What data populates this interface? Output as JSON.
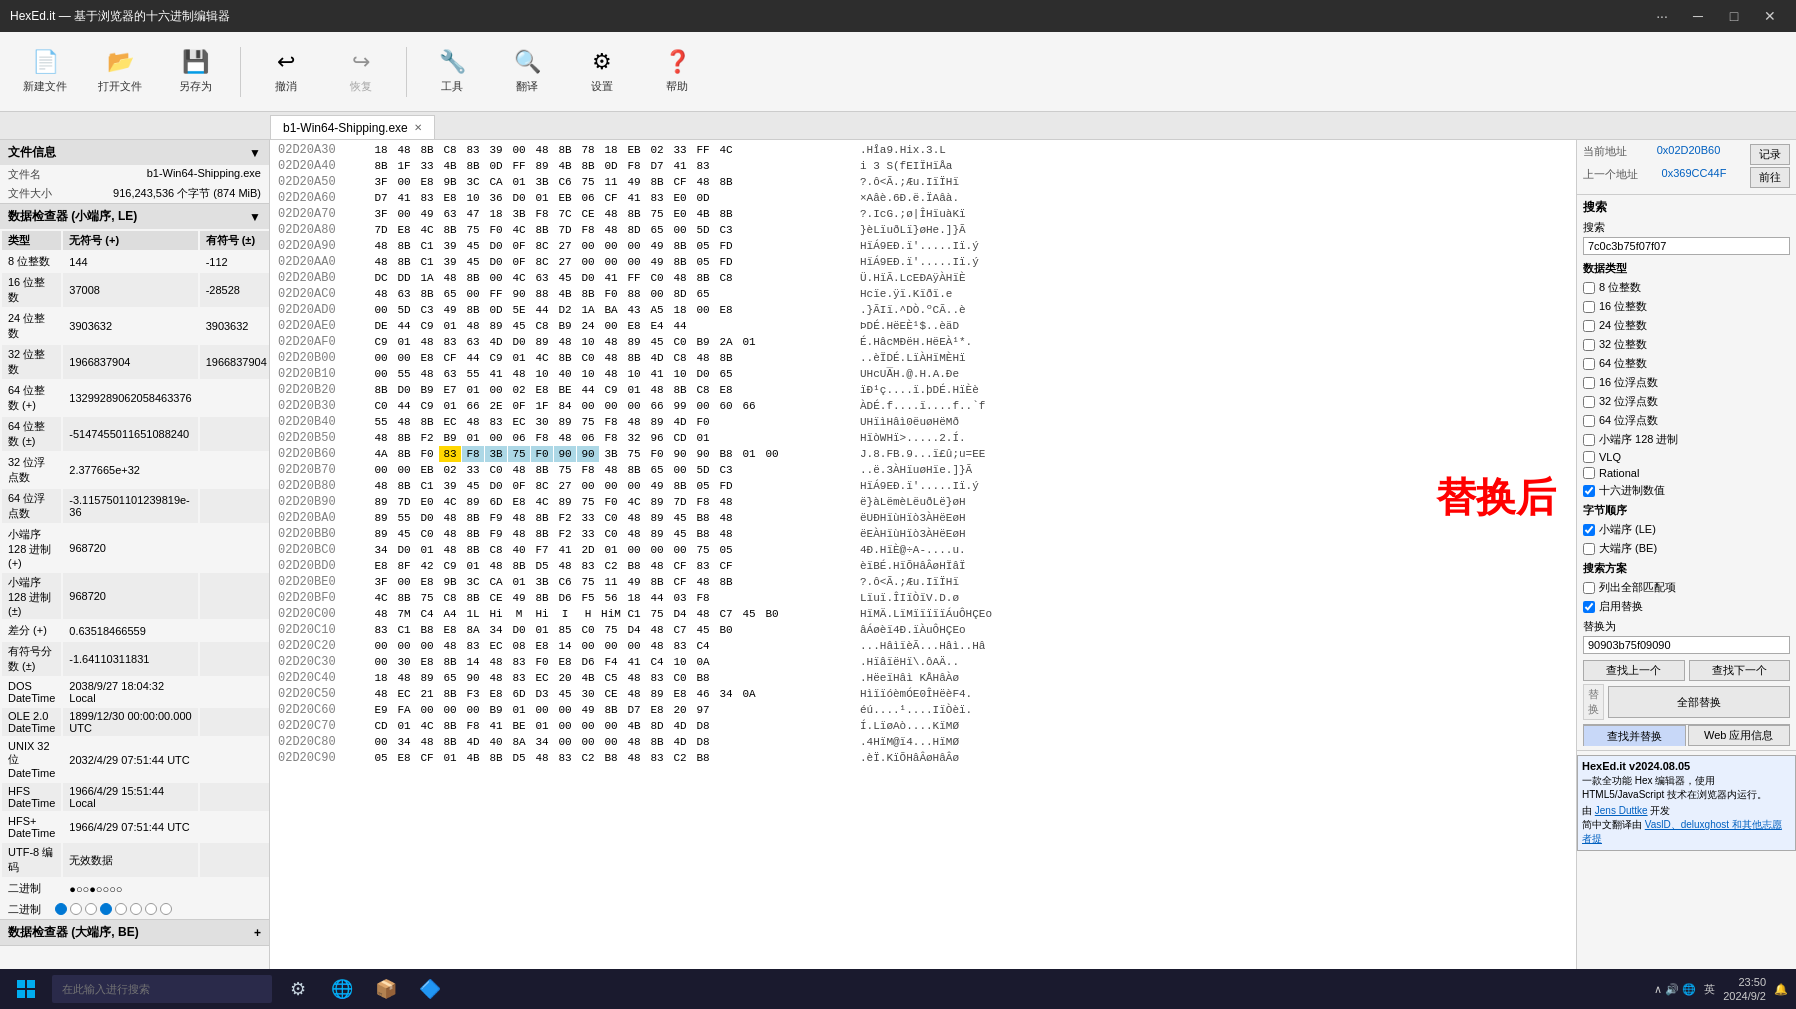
{
  "titlebar": {
    "title": "HexEd.it — 基于浏览器的十六进制编辑器",
    "minimize": "─",
    "restore": "□",
    "close": "✕",
    "more": "···"
  },
  "toolbar": {
    "items": [
      {
        "id": "new",
        "icon": "📄",
        "label": "新建文件"
      },
      {
        "id": "open",
        "icon": "📂",
        "label": "打开文件"
      },
      {
        "id": "saveas",
        "icon": "💾",
        "label": "另存为"
      },
      {
        "id": "undo",
        "icon": "↩",
        "label": "撤消"
      },
      {
        "id": "redo",
        "icon": "↪",
        "label": "恢复"
      },
      {
        "id": "tools",
        "icon": "🔧",
        "label": "工具"
      },
      {
        "id": "translate",
        "icon": "🔍",
        "label": "翻译"
      },
      {
        "id": "settings",
        "icon": "⚙",
        "label": "设置"
      },
      {
        "id": "help",
        "icon": "❓",
        "label": "帮助"
      }
    ]
  },
  "tab": {
    "label": "b1-Win64-Shipping.exe",
    "close": "✕"
  },
  "left_panel": {
    "file_info_title": "文件信息",
    "file_info": {
      "name_label": "文件名",
      "name_val": "b1-Win64-Shipping.exe",
      "size_label": "文件大小",
      "size_val": "916,243,536 个字节 (874 MiB)"
    },
    "checker_title": "数据检查器 (小端序, LE)",
    "type_header": [
      "类型",
      "无符号 (+)",
      "有符号 (±)"
    ],
    "types": [
      [
        "8 位整数",
        "144",
        "-112"
      ],
      [
        "16 位整数",
        "37008",
        "-28528"
      ],
      [
        "24 位整数",
        "3903632",
        "3903632"
      ],
      [
        "32 位整数",
        "1966837904",
        "1966837904"
      ],
      [
        "64 位整数 (+)",
        "13299289062058463376",
        ""
      ],
      [
        "64 位整数 (±)",
        "-5147455011651088240",
        ""
      ],
      [
        "32 位浮点数",
        "2.377665e+32",
        ""
      ],
      [
        "64 位浮点数",
        "-3.1157501101239819e-36",
        ""
      ],
      [
        "小端序 128 进制 (+)",
        "968720",
        ""
      ],
      [
        "小端序 128 进制 (±)",
        "968720",
        ""
      ],
      [
        "差分 (+)",
        "0.63518466559",
        ""
      ],
      [
        "有符号分数 (±)",
        "-1.64110311831",
        ""
      ],
      [
        "DOS DateTime",
        "2038/9/27 18:04:32 Local",
        ""
      ],
      [
        "OLE 2.0 DateTime",
        "1899/12/30 00:00:00.000 UTC",
        ""
      ],
      [
        "UNIX 32 位 DateTime",
        "2032/4/29 07:51:44 UTC",
        ""
      ],
      [
        "HFS DateTime",
        "1966/4/29 15:51:44 Local",
        ""
      ],
      [
        "HFS+ DateTime",
        "1966/4/29 07:51:44 UTC",
        ""
      ],
      [
        "UTF-8 编码",
        "无效数据",
        ""
      ],
      [
        "二进制",
        "●○○●○○○○",
        ""
      ]
    ],
    "checker2_title": "数据检查器 (大端序, BE)"
  },
  "hex_rows": [
    {
      "addr": "02D20A30",
      "bytes": "18 48 8B C8 83 39 00 48 8B 78 18 EB 02 33 FF 4C",
      "ascii": ".Hi̊a9.Hix.3.L"
    },
    {
      "addr": "02D20A40",
      "bytes": "8B 1F 33 4B 8B 0D FF 89 4B 8B 0D F8 D7 41 83",
      "ascii": "i 3 S(fEIΪHïÅa"
    },
    {
      "addr": "02D20A50",
      "bytes": "3F 00 E8 9B 3C CA 01 3B C6 75 11 49 8B CF 48 8B",
      "ascii": "?.ô<Ã.;Æu.IïÏHï"
    },
    {
      "addr": "02D20A60",
      "bytes": "D7 41 83 E8 10 36 D0 01 EB 06 CF 41 83 E0 0D",
      "ascii": "×Aâè.6Ð.ë.ÏAâà."
    },
    {
      "addr": "02D20A70",
      "bytes": "3F 00 49 63 47 18 3B F8 7C CE 48 8B 75 E0 4B 8B",
      "ascii": "?.IcG.;ø|ÎHïuàKï"
    },
    {
      "addr": "02D20A80",
      "bytes": "7D E8 4C 8B 75 F0 4C 8B 7D F8 48 8D 65 00 5D C3",
      "ascii": "}èLïuðLï}øHe.]}Ã"
    },
    {
      "addr": "02D20A90",
      "bytes": "48 8B C1 39 45 D0 0F 8C 27 00 00 00 49 8B 05 FD",
      "ascii": "HïÁ9EÐ.ï'.....Iï.ý"
    },
    {
      "addr": "02D20AA0",
      "bytes": "48 8B C1 39 45 D0 0F 8C 27 00 00 00 49 8B 05 FD",
      "ascii": "HïÁ9EÐ.ï'.....Iï.ý"
    },
    {
      "addr": "02D20AB0",
      "bytes": "DC DD 1A 48 8B 00 4C 63 45 D0 41 FF C0 48 8B C8",
      "ascii": "Ü.HïÃ.LcEÐAÿÀHïÈ"
    },
    {
      "addr": "02D20AC0",
      "bytes": "48 63 8B 65 00 FF 90 88 4B 8B F0 88 00 8D 65",
      "ascii": "Hcïe.ÿï.Kïðï.e"
    },
    {
      "addr": "02D20AD0",
      "bytes": "00 5D C3 49 8B 0D 5E 44 D2 1A BA 43 A5 18 00 E8",
      "ascii": ".}ÃIï.^DÒ.ºCÃ..è"
    },
    {
      "addr": "02D20AE0",
      "bytes": "DE 44 C9 01 48 89 45 C8 B9 24 00 E8 E4 44",
      "ascii": "ÞDÉ.HëEÈ¹$..èäD"
    },
    {
      "addr": "02D20AF0",
      "bytes": "C9 01 48 83 63 4D D0 89 48 10 48 89 45 C0 B9 2A 01",
      "ascii": "É.HâcMÐëH.HëEÀ¹*."
    },
    {
      "addr": "02D20B00",
      "bytes": "00 00 E8 CF 44 C9 01 4C 8B C0 48 8B 4D C8 48 8B",
      "ascii": "..èÏDÉ.LïÀHïMÈHï"
    },
    {
      "addr": "02D20B10",
      "bytes": "00 55 48 63 55 41 48 10 40 10 48 10 41 10 D0 65",
      "ascii": "UHcUA̅H.@.H.A.Ðe"
    },
    {
      "addr": "02D20B20",
      "bytes": "8B D0 B9 E7 01 00 02 E8 BE 44 C9 01 48 8B C8 E8",
      "ascii": "ïÐ¹ç....ï.þDÉ.HïÈè"
    },
    {
      "addr": "02D20B30",
      "bytes": "C0 44 C9 01 66 2E 0F 1F 84 00 00 00 66 99 00 60 66",
      "ascii": "ÀDÉ.f....ï....f..`f"
    },
    {
      "addr": "02D20B40",
      "bytes": "55 48 8B EC 48 83 EC 30 89 75 F8 48 89 4D F0",
      "ascii": "UHïìHâì0ëuøHëMð"
    },
    {
      "addr": "02D20B50",
      "bytes": "48 8B F2 B9 01 00 06 F8 48 06 F8 32 96 CD 01",
      "ascii": "HïòWHï>.....2.Í."
    },
    {
      "addr": "02D20B60",
      "bytes": "4A 8B F0 83 F8 3B 75 F0 90 90 3B 75 F0 90 90 B8 01 00",
      "ascii": "J.8.FB.9...ï£û;u=EE"
    },
    {
      "addr": "02D20B70",
      "bytes": "00 00 EB 02 33 C0 48 8B 75 F8 48 8B 65 00 5D C3",
      "ascii": "..ë.3ÀHïuøHïe.]}Ã"
    },
    {
      "addr": "02D20B80",
      "bytes": "48 8B C1 39 45 D0 0F 8C 27 00 00 00 49 8B 05 FD",
      "ascii": "HïÁ9EÐ.ï'.....Iï.ý"
    },
    {
      "addr": "02D20B90",
      "bytes": "89 7D E0 4C 89 6D E8 4C 89 75 F0 4C 89 7D F8 48",
      "ascii": "ë}àLëmèLëuðLë}øH"
    },
    {
      "addr": "02D20BA0",
      "bytes": "89 55 D0 48 8B F9 48 8B F2 33 C0 48 89 45 B8 48",
      "ascii": "ëUÐHïùHïò3ÀHëEøH"
    },
    {
      "addr": "02D20BB0",
      "bytes": "89 45 C0 48 8B F9 48 8B F2 33 C0 48 89 45 B8 48",
      "ascii": "ëEÀHïùHïò3ÀHëEøH"
    },
    {
      "addr": "02D20BC0",
      "bytes": "34 D0 01 48 8B C8 40 F7 41 2D 01 00 00 00 75 05",
      "ascii": "4Ð.HïÈ@÷A-....u."
    },
    {
      "addr": "02D20BD0",
      "bytes": "E8 8F 42 C9 01 48 8B D5 48 83 C2 B8 48 CF 83 CF",
      "ascii": "èïBÉ.HïÕHâÂøHÏâÏ"
    },
    {
      "addr": "02D20BE0",
      "bytes": "3F 00 E8 9B 3C CA 01 3B C6 75 11 49 8B CF 48 8B",
      "ascii": "?.ô<Ã.;Æu.IïÏHï"
    },
    {
      "addr": "02D20BF0",
      "bytes": "4C 8B 75 C8 8B CE 49 8B D6 F5 56 18 44 03 F8",
      "ascii": "Lïuï.ÎIïÒïV.D.ø"
    },
    {
      "addr": "02D20C00",
      "bytes": "48 7M C4 A4 1L Hi M Hi I H HiM C1 75 D4 48 C7 45 B0",
      "ascii": "HïMÄ.LïMïïïïïÁuÔHÇEo"
    },
    {
      "addr": "02D20C10",
      "bytes": "83 C1 B8 E8 8A 34 D0 01 85 C0 75 D4 48 C7 45 B0",
      "ascii": "âÁøèï4Ð.ïÀuÔHÇEo"
    },
    {
      "addr": "02D20C20",
      "bytes": "00 00 00 48 83 EC 08 E8 14 00 00 00 48 83 C4",
      "ascii": "...HâìïèÃ...Hâì..Hâ"
    },
    {
      "addr": "02D20C30",
      "bytes": "00 30 E8 8B 14 48 83 F0 E8 D6 F4 41 C4 10 0A",
      "ascii": ".HïâïëHï\\.ôAÄ.."
    },
    {
      "addr": "02D20C40",
      "bytes": "18 48 89 65 90 48 83 EC 20 4B C5 48 83 C0 B8",
      "ascii": ".HëeïHâì KÅHâÀø"
    },
    {
      "addr": "02D20C50",
      "bytes": "48 EC 21 8B F3 E8 6D D3 45 30 CE 48 89 E8 46 34 0A",
      "ascii": "HìïïóèmÓE0ÎHëèF4."
    },
    {
      "addr": "02D20C60",
      "bytes": "E9 FA 00 00 00 B9 01 00 00 49 8B D7 E8 20 97",
      "ascii": "éú....¹....IïÒèï."
    },
    {
      "addr": "02D20C70",
      "bytes": "CD 01 4C 8B F8 41 BE 01 00 00 00 4B 8D 4D D8",
      "ascii": "Í.LïøAò....KïMØ"
    },
    {
      "addr": "02D20C80",
      "bytes": "00 34 48 8B 4D 40 8A 34 00 00 00 48 8B 4D D8",
      "ascii": ".4HïM@ï4...HïMØ"
    },
    {
      "addr": "02D20C90",
      "bytes": "05 E8 CF 01 4B 8B D5 48 83 C2 B8 48 83 C2 B8",
      "ascii": ".èÏ.KïÕHâÂøHâÂø"
    }
  ],
  "right_panel": {
    "current_addr_label": "当前地址",
    "current_addr_val": "0x02D20B60",
    "log_btn": "记录",
    "prev_addr_label": "上一个地址",
    "prev_addr_val": "0x369CC44F",
    "prev_btn": "前往",
    "search_title": "搜索",
    "search_label": "搜索",
    "search_val": "7c0c3b75f07f07",
    "data_type_label": "数据类型",
    "checkboxes": [
      {
        "label": "8 位整数",
        "checked": false
      },
      {
        "label": "16 位整数",
        "checked": false
      },
      {
        "label": "24 位整数",
        "checked": false
      },
      {
        "label": "32 位整数",
        "checked": false
      },
      {
        "label": "64 位整数",
        "checked": false
      },
      {
        "label": "16 位浮点数",
        "checked": false
      },
      {
        "label": "32 位浮点数",
        "checked": false
      },
      {
        "label": "64 位浮点数",
        "checked": false
      },
      {
        "label": "小端序 128 进制",
        "checked": false
      },
      {
        "label": "VLQ",
        "checked": false
      },
      {
        "label": "Rational",
        "checked": false
      },
      {
        "label": "十六进制数值",
        "checked": true
      }
    ],
    "byte_order_label": "字节顺序",
    "byte_order_options": [
      {
        "label": "小端序 (LE)",
        "checked": true
      },
      {
        "label": "大端序 (BE)",
        "checked": false
      }
    ],
    "search_scheme_label": "搜索方案",
    "search_scheme_options": [
      {
        "label": "列出全部匹配项",
        "checked": false
      },
      {
        "label": "启用替换",
        "checked": true
      }
    ],
    "replace_label": "替换为",
    "replace_val": "90903b75f09090",
    "find_prev_btn": "查找上一个",
    "find_next_btn": "查找下一个",
    "replace_btn": "替换",
    "replace_all_btn": "全部替换",
    "tab_search": "查找并替换",
    "tab_web": "Web 应用信息",
    "info_title": "HexEd.it v2024.08.05",
    "info_desc": "一款全功能 Hex 编辑器，使用 HTML5/JavaScript 技术在浏览器内运行。",
    "author_label": "由",
    "author": "Jens Duttke",
    "author_suffix": "开发",
    "translate_label": "简中文翻译由",
    "translators": "VaslD、deluxghost 和其他志愿者提"
  },
  "replace_overlay": "替换后",
  "taskbar": {
    "search_placeholder": "在此输入进行搜索",
    "time": "23:50",
    "date": "2024/9/2",
    "lang": "英"
  }
}
